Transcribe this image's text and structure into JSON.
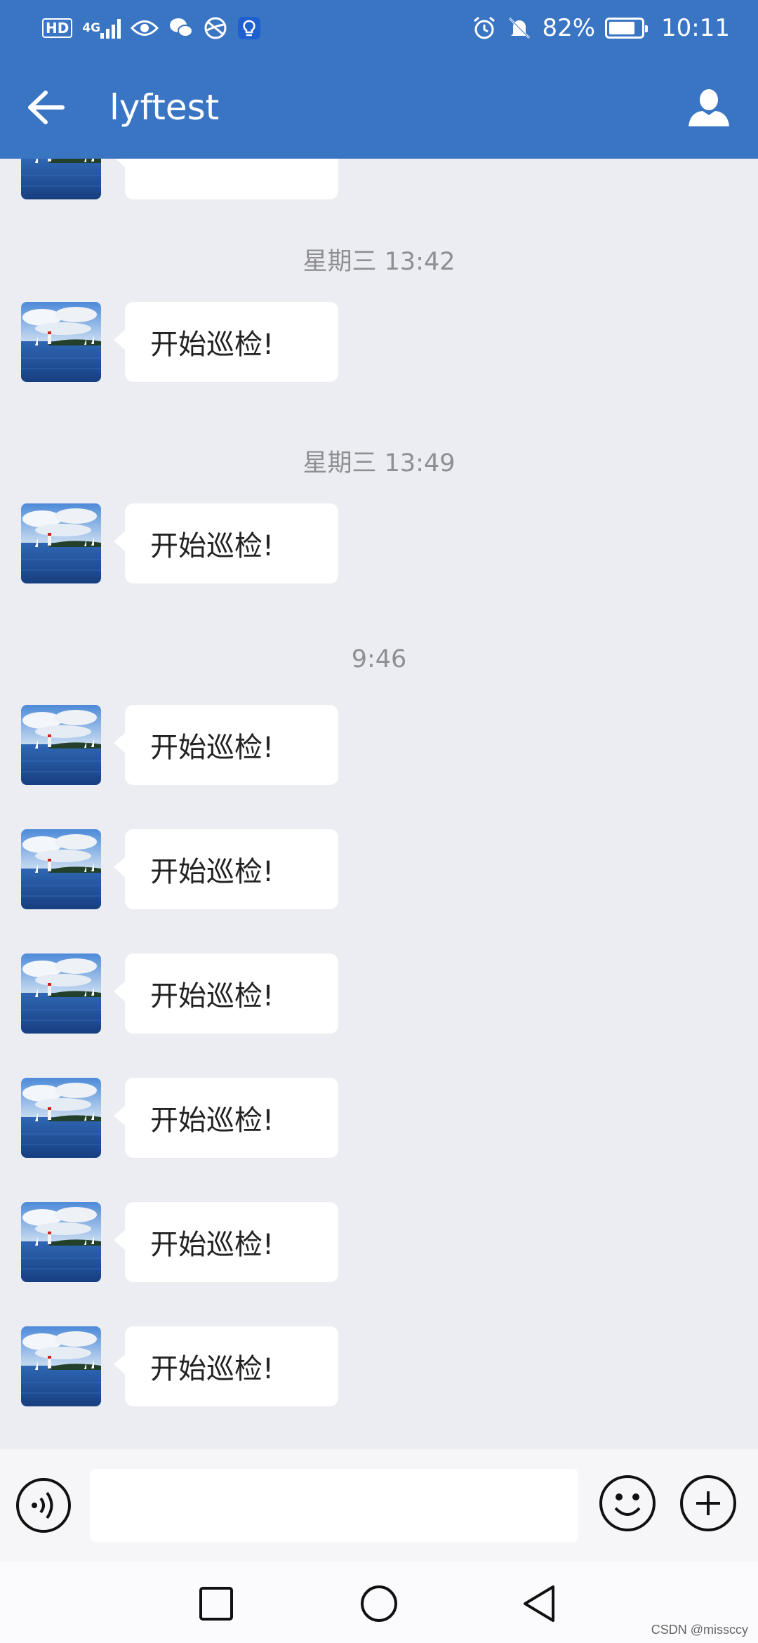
{
  "status_bar": {
    "hd": "HD",
    "network": "4G",
    "battery_percent": "82%",
    "battery_level": 0.82,
    "time": "10:11",
    "icons": [
      "hd-icon",
      "signal-icon",
      "eye-icon",
      "wechat-icon",
      "ball-icon",
      "bulb-icon",
      "alarm-icon",
      "mute-icon",
      "battery-icon"
    ]
  },
  "header": {
    "title": "lyftest",
    "back_icon": "back-arrow-icon",
    "profile_icon": "person-icon"
  },
  "messages": [
    {
      "type": "partial"
    },
    {
      "type": "time",
      "text": "星期三  13:42"
    },
    {
      "type": "msg",
      "text": "开始巡检!"
    },
    {
      "type": "time",
      "text": "星期三  13:49"
    },
    {
      "type": "msg",
      "text": "开始巡检!"
    },
    {
      "type": "time",
      "text": "9:46"
    },
    {
      "type": "msg",
      "text": "开始巡检!"
    },
    {
      "type": "msg",
      "text": "开始巡检!"
    },
    {
      "type": "msg",
      "text": "开始巡检!"
    },
    {
      "type": "msg",
      "text": "开始巡检!"
    },
    {
      "type": "msg",
      "text": "开始巡检!"
    },
    {
      "type": "msg",
      "text": "开始巡检!"
    }
  ],
  "input_bar": {
    "placeholder": "",
    "voice_icon": "voice-icon",
    "emoji_icon": "emoji-icon",
    "plus_icon": "plus-icon"
  },
  "nav_bar": {
    "icons": [
      "recents-icon",
      "home-icon",
      "back-icon"
    ]
  },
  "watermark": "CSDN @missccy",
  "colors": {
    "header": "#3a75c4",
    "background": "#ecedf2",
    "bubble": "#ffffff"
  }
}
